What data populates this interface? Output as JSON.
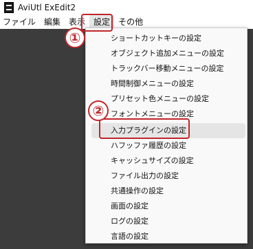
{
  "window": {
    "title": "AviUtl ExEdit2"
  },
  "menubar": {
    "items": [
      "ファイル",
      "編集",
      "表示",
      "設定",
      "その他"
    ]
  },
  "settings_menu": {
    "items": [
      "ショートカットキーの設定",
      "オブジェクト追加メニューの設定",
      "トラックバー移動メニューの設定",
      "時間制御メニューの設定",
      "プリセット色メニューの設定",
      "フォントメニューの設定",
      "入力プラグインの設定",
      "ハフッファ履歴の設定",
      "キャッシュサイズの設定",
      "ファイル出力の設定",
      "共通操作の設定",
      "画面の設定",
      "ログの設定",
      "言語の設定"
    ]
  },
  "annotations": {
    "step1": "①",
    "step2": "②",
    "color": "#c0262a"
  }
}
